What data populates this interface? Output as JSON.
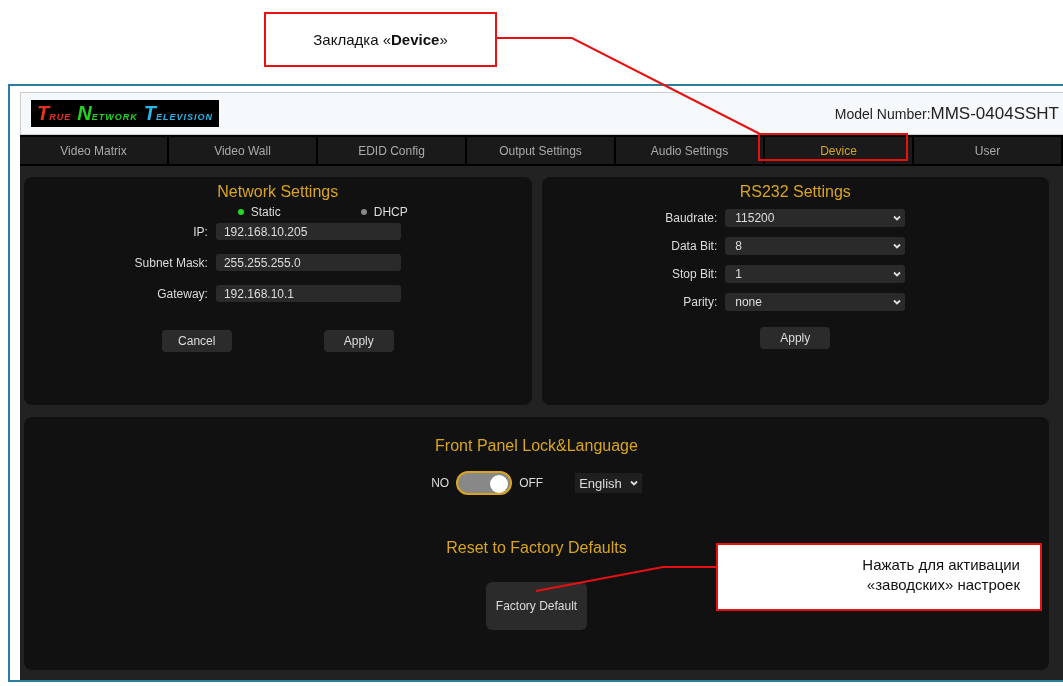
{
  "callouts": [
    {
      "kind": "tab",
      "before": "Закладка «",
      "bold": "Device",
      "after": "»"
    },
    {
      "kind": "reset",
      "lines": [
        "Нажать для активации",
        "«заводских»  настроек"
      ]
    }
  ],
  "header": {
    "logo": [
      {
        "initial": "T",
        "rest": "RUE",
        "color": "#e8321e"
      },
      {
        "initial": "N",
        "rest": "ETWORK",
        "color": "#22d422"
      },
      {
        "initial": "T",
        "rest": "ELEVISION",
        "color": "#2ab4e8"
      }
    ],
    "model_label": "Model Number:",
    "model_value": "MMS-0404SSHT"
  },
  "tabs": [
    {
      "label": "Video Matrix",
      "selected": false
    },
    {
      "label": "Video Wall",
      "selected": false
    },
    {
      "label": "EDID Config",
      "selected": false
    },
    {
      "label": "Output Settings",
      "selected": false
    },
    {
      "label": "Audio Settings",
      "selected": false
    },
    {
      "label": "Device",
      "selected": true
    },
    {
      "label": "User",
      "selected": false
    }
  ],
  "network": {
    "title": "Network Settings",
    "modes": [
      {
        "label": "Static",
        "selected": true
      },
      {
        "label": "DHCP",
        "selected": false
      }
    ],
    "fields": [
      {
        "label": "IP:",
        "value": "192.168.10.205"
      },
      {
        "label": "Subnet Mask:",
        "value": "255.255.255.0"
      },
      {
        "label": "Gateway:",
        "value": "192.168.10.1"
      }
    ],
    "buttons": [
      "Cancel",
      "Apply"
    ]
  },
  "rs232": {
    "title": "RS232 Settings",
    "fields": [
      {
        "label": "Baudrate:",
        "value": "115200"
      },
      {
        "label": "Data Bit:",
        "value": "8"
      },
      {
        "label": "Stop Bit:",
        "value": "1"
      },
      {
        "label": "Parity:",
        "value": "none"
      }
    ],
    "button": "Apply"
  },
  "front_panel": {
    "title": "Front Panel Lock&Language",
    "left_label": "NO",
    "right_label": "OFF",
    "on": true,
    "language": "English"
  },
  "reset": {
    "title": "Reset to Factory Defaults",
    "button": "Factory Default"
  }
}
